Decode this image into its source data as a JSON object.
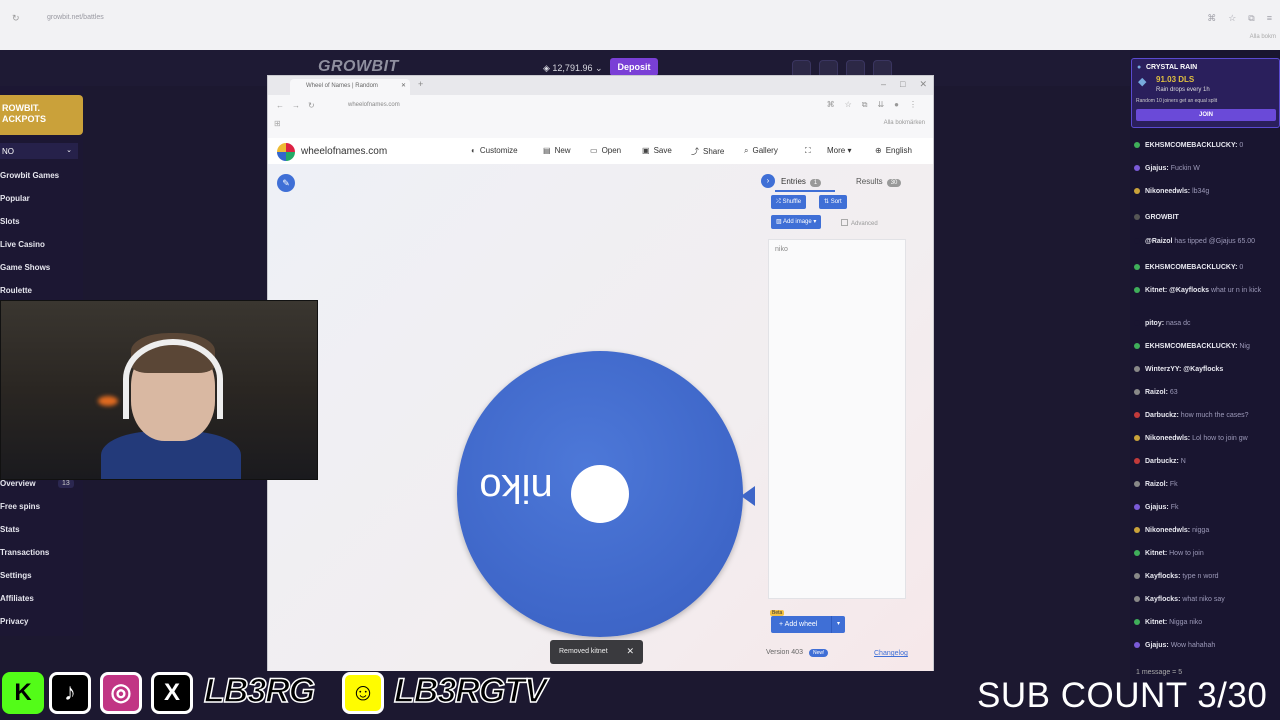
{
  "outer_browser": {
    "url": "growbit.net/battles",
    "bookmarks": "Alla bokm"
  },
  "growbit": {
    "logo": "GROWBIT",
    "balance": "12,791.96",
    "deposit_label": "Deposit",
    "jackpot_label": "ROWBIT. ACKPOTS",
    "language": "NO",
    "sidebar": [
      {
        "label": "Growbit Games"
      },
      {
        "label": "Popular"
      },
      {
        "label": "Slots"
      },
      {
        "label": "Live Casino"
      },
      {
        "label": "Game Shows"
      },
      {
        "label": "Roulette"
      },
      {
        "label": "Overview",
        "badge": "13"
      },
      {
        "label": "Free spins"
      },
      {
        "label": "Stats"
      },
      {
        "label": "Transactions"
      },
      {
        "label": "Settings"
      },
      {
        "label": "Affiliates"
      },
      {
        "label": "Privacy"
      }
    ]
  },
  "inner_browser": {
    "tab_title": "Wheel of Names | Random",
    "url": "wheelofnames.com",
    "bookmarks": "Alla bokmärken"
  },
  "wheelofnames": {
    "site": "wheelofnames.com",
    "menu": [
      "Customize",
      "New",
      "Open",
      "Save",
      "Share",
      "Gallery",
      "More",
      "English"
    ],
    "wheel_label": "niko",
    "tabs": {
      "entries": "Entries",
      "entries_count": "1",
      "results": "Results",
      "results_count": "30"
    },
    "buttons": {
      "shuffle": "Shuffle",
      "sort": "Sort",
      "add_image": "Add image",
      "advanced": "Advanced",
      "add_wheel": "Add wheel",
      "beta": "Beta"
    },
    "entries": [
      "niko"
    ],
    "version": "Version 403",
    "new_badge": "New!",
    "changelog": "Changelog"
  },
  "toast": {
    "text": "Removed kitnet"
  },
  "chat": {
    "rain": {
      "title": "CRYSTAL RAIN",
      "amount": "91.03 DLS",
      "subtitle": "Rain drops every 1h",
      "description": "Random 10 joiners get an equal split",
      "join_label": "JOIN"
    },
    "messages": [
      {
        "user": "EKHSMCOMEBACKLUCKY:",
        "text": "0",
        "color": "#3fae5a"
      },
      {
        "user": "Gjajus:",
        "text": "Fuckin W",
        "color": "#7a5ad8"
      },
      {
        "user": "Nikoneedwls:",
        "text": "lb34g",
        "color": "#c9a23a"
      },
      {
        "user": "GROWBIT",
        "text": "",
        "color": "#555"
      },
      {
        "user": "@Raizol",
        "text": "has tipped @Gjajus 65.00",
        "color": "#191530"
      },
      {
        "user": "EKHSMCOMEBACKLUCKY:",
        "text": "0",
        "color": "#3fae5a"
      },
      {
        "user": "Kitnet: @Kayflocks",
        "text": "what ur n in kick",
        "color": "#3fae5a"
      },
      {
        "user": "pitoy:",
        "text": "nasa dc",
        "color": "#191530"
      },
      {
        "user": "EKHSMCOMEBACKLUCKY:",
        "text": "Nig",
        "color": "#3fae5a"
      },
      {
        "user": "WinterzYY: @Kayflocks",
        "text": "",
        "color": "#888"
      },
      {
        "user": "Raizol:",
        "text": "63",
        "color": "#888"
      },
      {
        "user": "Darbuckz:",
        "text": "how much the cases?",
        "color": "#c23a3a"
      },
      {
        "user": "Nikoneedwls:",
        "text": "Lol how to join gw",
        "color": "#c9a23a"
      },
      {
        "user": "Darbuckz:",
        "text": "N",
        "color": "#c23a3a"
      },
      {
        "user": "Raizol:",
        "text": "Fk",
        "color": "#888"
      },
      {
        "user": "Gjajus:",
        "text": "Fk",
        "color": "#7a5ad8"
      },
      {
        "user": "Nikoneedwls:",
        "text": "nigga",
        "color": "#c9a23a"
      },
      {
        "user": "Kitnet:",
        "text": "How to join",
        "color": "#3fae5a"
      },
      {
        "user": "Kayflocks:",
        "text": "type n word",
        "color": "#888"
      },
      {
        "user": "Kayflocks:",
        "text": "what niko say",
        "color": "#888"
      },
      {
        "user": "Kitnet:",
        "text": "Nigga niko",
        "color": "#3fae5a"
      },
      {
        "user": "Gjajus:",
        "text": "Wow hahahah",
        "color": "#7a5ad8"
      }
    ],
    "footer": "1 message = 5"
  },
  "overlay": {
    "handle1": "LB3RG",
    "handle2": "LB3RGTV",
    "sub_count": "SUB COUNT 3/30"
  }
}
